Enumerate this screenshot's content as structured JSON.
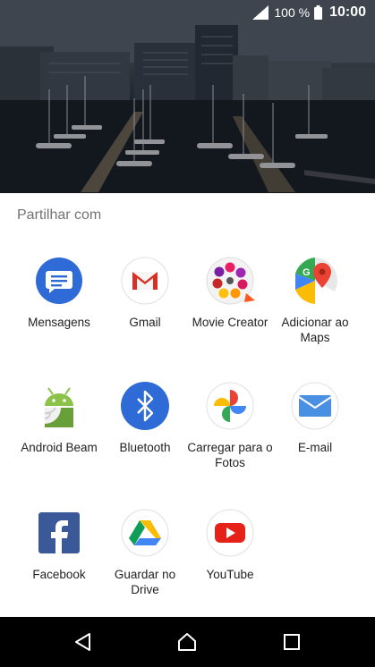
{
  "status_bar": {
    "battery_percent": "100 %",
    "time": "10:00",
    "signal_icon": "signal-icon",
    "battery_icon": "battery-icon"
  },
  "share_sheet": {
    "title": "Partilhar com",
    "apps": [
      {
        "label": "Mensagens",
        "icon": "messages-icon"
      },
      {
        "label": "Gmail",
        "icon": "gmail-icon"
      },
      {
        "label": "Movie Creator",
        "icon": "movie-creator-icon"
      },
      {
        "label": "Adicionar ao Maps",
        "icon": "maps-icon"
      },
      {
        "label": "Android Beam",
        "icon": "android-beam-icon"
      },
      {
        "label": "Bluetooth",
        "icon": "bluetooth-icon"
      },
      {
        "label": "Carregar para o Fotos",
        "icon": "photos-icon"
      },
      {
        "label": "E-mail",
        "icon": "email-icon"
      },
      {
        "label": "Facebook",
        "icon": "facebook-icon"
      },
      {
        "label": "Guardar no Drive",
        "icon": "drive-icon"
      },
      {
        "label": "YouTube",
        "icon": "youtube-icon"
      }
    ]
  },
  "nav_bar": {
    "back_icon": "back-icon",
    "home_icon": "home-icon",
    "recents_icon": "recents-icon"
  },
  "colors": {
    "messages_blue": "#2f6bd6",
    "gmail_red": "#d93025",
    "bluetooth_blue": "#2f6bd6",
    "android_green": "#8bc34a",
    "email_blue": "#4a90e2",
    "facebook_blue": "#3b5998",
    "youtube_red": "#e62117",
    "sheet_background": "#ffffff",
    "title_gray": "#737373"
  }
}
